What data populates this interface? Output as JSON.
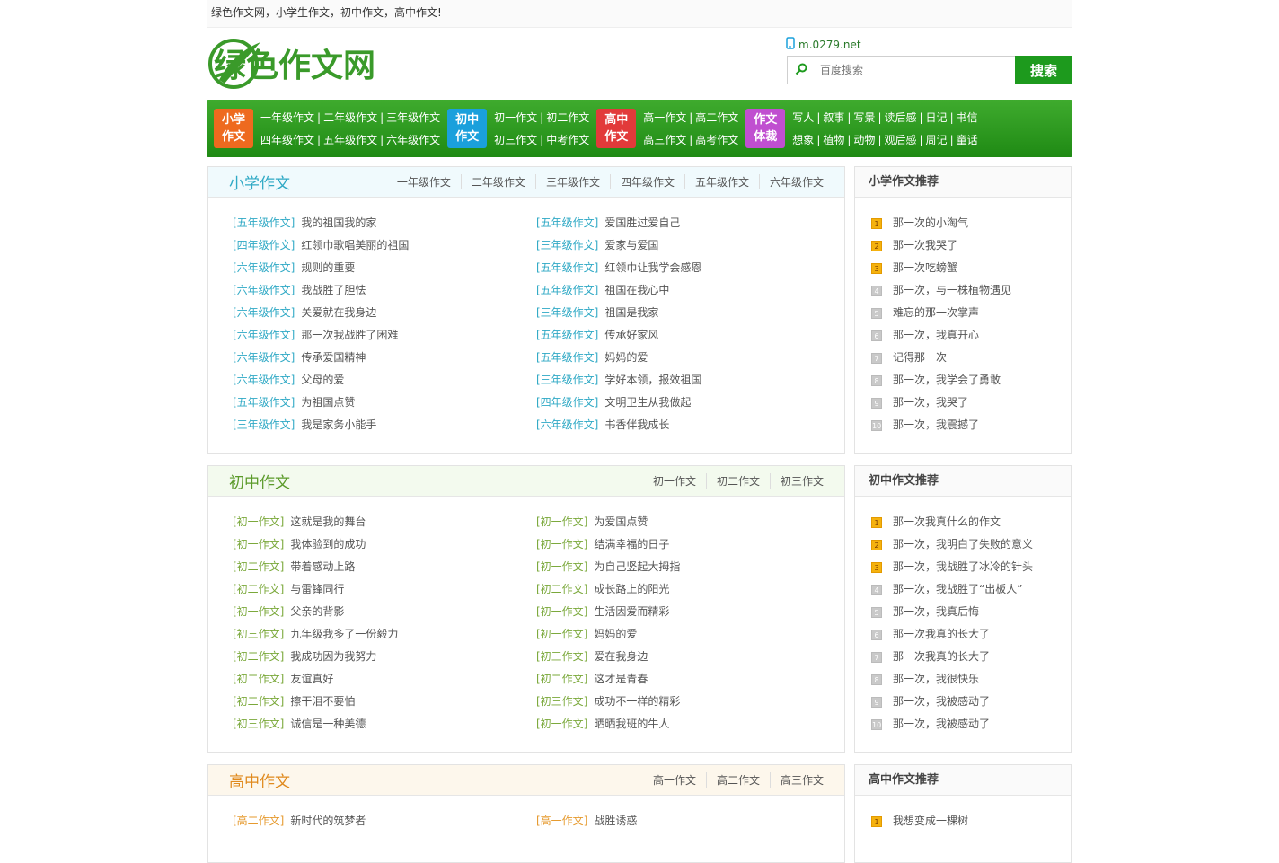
{
  "topbar": {
    "text": "绿色作文网，小学生作文，初中作文，高中作文!"
  },
  "header": {
    "logo_text": "绿色作文网",
    "mobile_link": "m.0279.net",
    "search_placeholder": "百度搜索",
    "search_button": "搜索"
  },
  "nav": {
    "groups": [
      {
        "badge": [
          "小学",
          "作文"
        ],
        "color": "#ee6a1f",
        "rows": [
          [
            "一年级作文",
            "二年级作文",
            "三年级作文"
          ],
          [
            "四年级作文",
            "五年级作文",
            "六年级作文"
          ]
        ]
      },
      {
        "badge": [
          "初中",
          "作文"
        ],
        "color": "#1aa0dc",
        "rows": [
          [
            "初一作文",
            "初二作文"
          ],
          [
            "初三作文",
            "中考作文"
          ]
        ]
      },
      {
        "badge": [
          "高中",
          "作文"
        ],
        "color": "#e23a3a",
        "rows": [
          [
            "高一作文",
            "高二作文"
          ],
          [
            "高三作文",
            "高考作文"
          ]
        ]
      },
      {
        "badge": [
          "作文",
          "体裁"
        ],
        "color": "#c04fd0",
        "rows": [
          [
            "写人",
            "叙事",
            "写景",
            "读后感",
            "日记",
            "书信"
          ],
          [
            "想象",
            "植物",
            "动物",
            "观后感",
            "周记",
            "童话"
          ]
        ]
      }
    ]
  },
  "sections": [
    {
      "title": "小学作文",
      "title_color": "#2fa9c5",
      "cat_color": "#2fa9c5",
      "head_bg": "#f0fafd",
      "tabs": [
        "一年级作文",
        "二年级作文",
        "三年级作文",
        "四年级作文",
        "五年级作文",
        "六年级作文"
      ],
      "articles": [
        {
          "cat": "[五年级作文]",
          "title": "我的祖国我的家"
        },
        {
          "cat": "[五年级作文]",
          "title": "爱国胜过爱自己"
        },
        {
          "cat": "[四年级作文]",
          "title": "红领巾歌唱美丽的祖国"
        },
        {
          "cat": "[三年级作文]",
          "title": "爱家与爱国"
        },
        {
          "cat": "[六年级作文]",
          "title": "规则的重要"
        },
        {
          "cat": "[五年级作文]",
          "title": "红领巾让我学会感恩"
        },
        {
          "cat": "[六年级作文]",
          "title": "我战胜了胆怯"
        },
        {
          "cat": "[五年级作文]",
          "title": "祖国在我心中"
        },
        {
          "cat": "[六年级作文]",
          "title": "关爱就在我身边"
        },
        {
          "cat": "[三年级作文]",
          "title": "祖国是我家"
        },
        {
          "cat": "[六年级作文]",
          "title": "那一次我战胜了困难"
        },
        {
          "cat": "[五年级作文]",
          "title": "传承好家风"
        },
        {
          "cat": "[六年级作文]",
          "title": "传承爱国精神"
        },
        {
          "cat": "[五年级作文]",
          "title": "妈妈的爱"
        },
        {
          "cat": "[六年级作文]",
          "title": "父母的爱"
        },
        {
          "cat": "[三年级作文]",
          "title": "学好本领，报效祖国"
        },
        {
          "cat": "[五年级作文]",
          "title": "为祖国点赞"
        },
        {
          "cat": "[四年级作文]",
          "title": "文明卫生从我做起"
        },
        {
          "cat": "[三年级作文]",
          "title": "我是家务小能手"
        },
        {
          "cat": "[六年级作文]",
          "title": "书香伴我成长"
        }
      ],
      "side_title": "小学作文推荐",
      "rank": [
        "那一次的小淘气",
        "那一次我哭了",
        "那一次吃螃蟹",
        "那一次，与一株植物遇见",
        "难忘的那一次掌声",
        "那一次，我真开心",
        "记得那一次",
        "那一次，我学会了勇敢",
        "那一次，我哭了",
        "那一次，我震撼了"
      ]
    },
    {
      "title": "初中作文",
      "title_color": "#5b9a2a",
      "cat_color": "#7aa83a",
      "head_bg": "#f3faee",
      "tabs": [
        "初一作文",
        "初二作文",
        "初三作文"
      ],
      "articles": [
        {
          "cat": "[初一作文]",
          "title": "这就是我的舞台"
        },
        {
          "cat": "[初一作文]",
          "title": "为爱国点赞"
        },
        {
          "cat": "[初一作文]",
          "title": "我体验到的成功"
        },
        {
          "cat": "[初一作文]",
          "title": "结满幸福的日子"
        },
        {
          "cat": "[初二作文]",
          "title": "带着感动上路"
        },
        {
          "cat": "[初一作文]",
          "title": "为自己竖起大拇指"
        },
        {
          "cat": "[初二作文]",
          "title": "与雷锋同行"
        },
        {
          "cat": "[初二作文]",
          "title": "成长路上的阳光"
        },
        {
          "cat": "[初一作文]",
          "title": "父亲的背影"
        },
        {
          "cat": "[初一作文]",
          "title": "生活因爱而精彩"
        },
        {
          "cat": "[初三作文]",
          "title": "九年级我多了一份毅力"
        },
        {
          "cat": "[初一作文]",
          "title": "妈妈的爱"
        },
        {
          "cat": "[初二作文]",
          "title": "我成功因为我努力"
        },
        {
          "cat": "[初三作文]",
          "title": "爱在我身边"
        },
        {
          "cat": "[初二作文]",
          "title": "友谊真好"
        },
        {
          "cat": "[初二作文]",
          "title": "这才是青春"
        },
        {
          "cat": "[初二作文]",
          "title": "擦干泪不要怕"
        },
        {
          "cat": "[初三作文]",
          "title": "成功不一样的精彩"
        },
        {
          "cat": "[初三作文]",
          "title": "诚信是一种美德"
        },
        {
          "cat": "[初一作文]",
          "title": "晒晒我班的牛人"
        }
      ],
      "side_title": "初中作文推荐",
      "rank": [
        "那一次我真什么的作文",
        "那一次，我明白了失败的意义",
        "那一次，我战胜了冰冷的针头",
        "那一次，我战胜了“出板人”",
        "那一次，我真后悔",
        "那一次我真的长大了",
        "那一次我真的长大了",
        "那一次，我很快乐",
        "那一次，我被感动了",
        "那一次，我被感动了"
      ]
    },
    {
      "title": "高中作文",
      "title_color": "#e08a1e",
      "cat_color": "#e69a2e",
      "head_bg": "#fdf7ec",
      "tabs": [
        "高一作文",
        "高二作文",
        "高三作文"
      ],
      "articles": [
        {
          "cat": "[高二作文]",
          "title": "新时代的筑梦者"
        },
        {
          "cat": "[高一作文]",
          "title": "战胜诱惑"
        }
      ],
      "side_title": "高中作文推荐",
      "rank": [
        "我想变成一棵树"
      ]
    }
  ]
}
